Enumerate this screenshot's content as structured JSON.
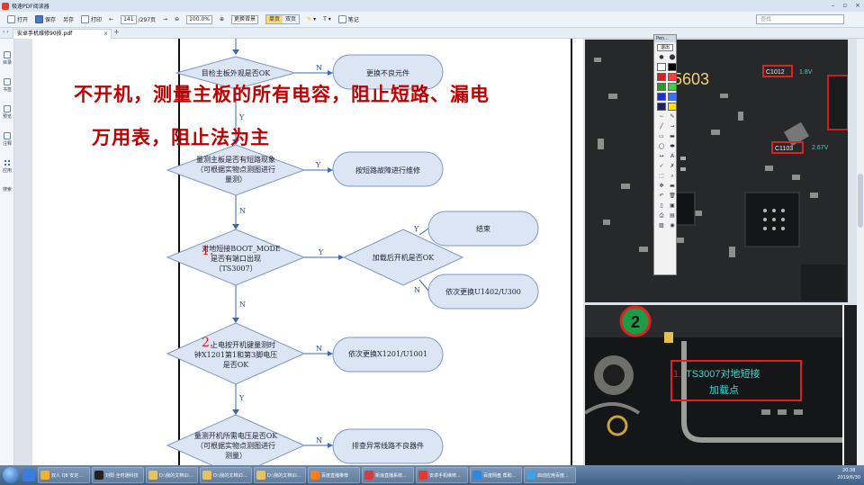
{
  "window": {
    "title": "极速PDF阅读器"
  },
  "toolbar": {
    "open": "打开",
    "save": "保存",
    "save_as": "另存",
    "print": "打印",
    "page_current": "141",
    "page_total": "/297页",
    "zoom": "100.0%",
    "bg_select": "更换背景",
    "single_page": "单页",
    "double_page": "双页",
    "notes": "笔记",
    "search_placeholder": "查找"
  },
  "tabs": [
    {
      "label": "安卓手机维修90技.pdf"
    }
  ],
  "sidebar": {
    "items": [
      "目录",
      "书签",
      "预览",
      "注释",
      "应用",
      "搜索"
    ]
  },
  "overlay": {
    "line1": "不开机，测量主板的所有电容，阻止短路、漏电",
    "line2": "万用表，阻止法为主"
  },
  "flowchart": {
    "n1": "目检主板外观是否OK",
    "n1_no": "更换不良元件",
    "n2": [
      "量测主板是否有短路现象",
      "（可根据实物点测图进行",
      "量测）"
    ],
    "n2_yes": "按短路故障进行维修",
    "n3": [
      "对地短接BOOT_MODE",
      "是否有端口出现",
      "（TS3007）"
    ],
    "n3_step": "1.",
    "n3b": "加载后开机是否OK",
    "n3b_yes": "结束",
    "n3b_no": "依次更换U1402/U300",
    "n4": [
      "上电按开机键量测时",
      "钟X1201第1和第3脚电压",
      "是否OK"
    ],
    "n4_step": "2.",
    "n4_no": "依次更换X1201/U1001",
    "n5": [
      "量测开机所需电压是否OK",
      "（可根据实物点测图进行",
      "测量）"
    ],
    "n5_no": "排查异常线路不良器件",
    "lbl_n": "N",
    "lbl_y": "Y"
  },
  "photo1": {
    "chip": "5603",
    "label_a": "C1012",
    "label_b": "C1103",
    "volt": "2.67V",
    "volt2": "1.8V"
  },
  "photo2": {
    "circle": "2",
    "step": "1.",
    "note_l1": "TS3007对地短接",
    "note_l2": "加载点"
  },
  "palette": {
    "title": "Pen...",
    "exit": "退出",
    "colors": [
      "#ffffff",
      "#000000",
      "#d61f1f",
      "#ff3a3a",
      "#22a31f",
      "#3bd43b",
      "#1f2fd6",
      "#3f6fff",
      "#1f1f6e",
      "#ffe000",
      "#22c7c7",
      "#9f3fd6"
    ]
  },
  "taskbar": {
    "items": [
      "双人 Q8 安定...",
      "刘阳 全时通科技",
      "D:\\我的文档\\D...",
      "D:\\我的文档\\D...",
      "D:\\我的文档\\D...",
      "百度直播推荐",
      "新浪直播系统...",
      "安卓手机维修...",
      "百度网盘 帮助...",
      "启动应用百度..."
    ],
    "time": "20:38",
    "date": "2019/6/30"
  }
}
